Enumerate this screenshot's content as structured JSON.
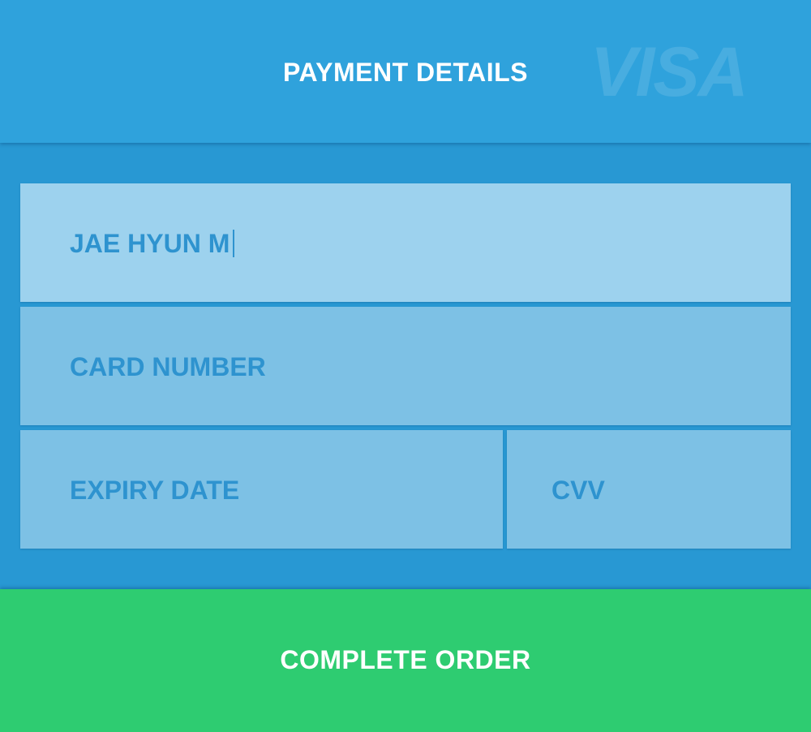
{
  "header": {
    "title": "PAYMENT DETAILS",
    "brand_logo_text": "VISA",
    "background_color": "#2fa2dc"
  },
  "form": {
    "cardholder_name": {
      "value": "JAE HYUN M",
      "focused": true
    },
    "card_number": {
      "placeholder": "CARD NUMBER",
      "value": ""
    },
    "expiry_date": {
      "placeholder": "EXPIRY DATE",
      "value": ""
    },
    "cvv": {
      "placeholder": "CVV",
      "value": ""
    },
    "panel_color": "#2898d3",
    "field_color": "#7dc1e5",
    "focused_field_color": "#9dd2ee",
    "field_text_color": "#2e93cf"
  },
  "submit": {
    "label": "COMPLETE ORDER",
    "color": "#2ecc71"
  }
}
